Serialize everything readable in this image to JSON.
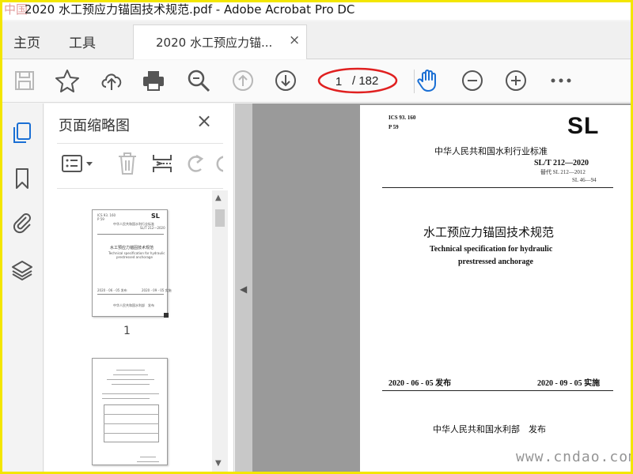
{
  "window": {
    "watermark_prefix": "中国",
    "title": "2020 水工预应力锚固技术规范.pdf - Adobe Acrobat Pro DC"
  },
  "menu": {
    "home": "主页",
    "tools": "工具"
  },
  "document_tab": {
    "label": "2020 水工预应力锚...",
    "close": "×"
  },
  "toolbar": {
    "icons": [
      "save-icon",
      "bookmark-star-icon",
      "upload-cloud-icon",
      "print-icon",
      "zoom-search-icon",
      "previous-page-icon",
      "next-page-icon",
      "hand-tool-icon",
      "zoom-out-icon",
      "zoom-in-icon",
      "more-icon"
    ],
    "current_page": "1",
    "total_pages": "/ 182",
    "highlight_color": "#e02020"
  },
  "left_rail": {
    "icons": [
      "page-thumbnails-icon",
      "bookmarks-icon",
      "attachments-icon",
      "layers-icon"
    ],
    "active_color": "#1a6fd4"
  },
  "thumbnail_panel": {
    "title": "页面缩略图",
    "close": "×",
    "tool_icons": [
      "thumbnail-options-icon",
      "delete-page-icon",
      "insert-page-icon",
      "rotate-page-icon"
    ],
    "thumbnails": [
      {
        "label": "1"
      },
      {
        "label": ""
      }
    ]
  },
  "pdf_page": {
    "ics": "ICS 93. 160",
    "classification": "P 59",
    "logo": "SL",
    "standard_type": "中华人民共和国水利行业标准",
    "code": "SL/T 212—2020",
    "replaces_line1": "替代 SL 212—2012",
    "replaces_line2": "SL 46—94",
    "title_cn": "水工预应力锚固技术规范",
    "title_en_line1": "Technical specification for hydraulic",
    "title_en_line2": "prestressed anchorage",
    "issue_date": "2020 - 06 - 05 发布",
    "implement_date": "2020 - 09 - 05 实施",
    "issuer": "中华人民共和国水利部　发布"
  },
  "site_watermark": "www.cndao.com"
}
